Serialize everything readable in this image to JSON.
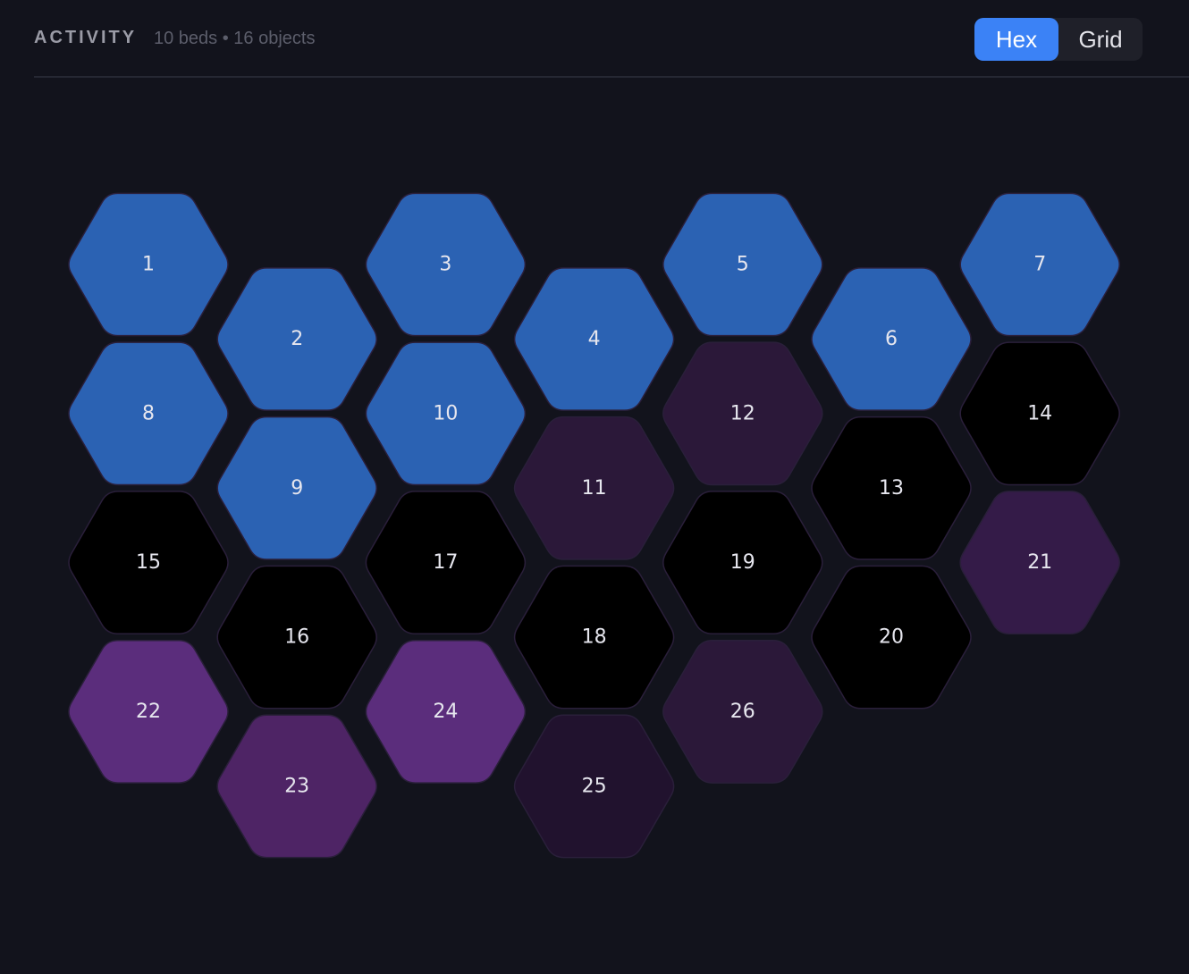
{
  "header": {
    "title": "ACTIVITY",
    "subtitle": "10 beds • 16 objects"
  },
  "view_toggle": {
    "options": [
      "Hex",
      "Grid"
    ],
    "selected": "Hex"
  },
  "palette": {
    "blue": "#2b62b3",
    "black": "#000000",
    "purple_dark": "#2b1839",
    "purple_mid": "#4e2465",
    "purple_bright": "#5b2d7c",
    "purple_soft": "#341b48",
    "purple_deep": "#21122e",
    "hex_border": "#2a1f3a",
    "toggle_accent": "#3b82f6"
  },
  "cells": [
    {
      "label": "1",
      "color": "blue"
    },
    {
      "label": "2",
      "color": "blue"
    },
    {
      "label": "3",
      "color": "blue"
    },
    {
      "label": "4",
      "color": "blue"
    },
    {
      "label": "5",
      "color": "blue"
    },
    {
      "label": "6",
      "color": "blue"
    },
    {
      "label": "7",
      "color": "blue"
    },
    {
      "label": "8",
      "color": "blue"
    },
    {
      "label": "9",
      "color": "blue"
    },
    {
      "label": "10",
      "color": "blue"
    },
    {
      "label": "11",
      "color": "purple_dark"
    },
    {
      "label": "12",
      "color": "purple_dark"
    },
    {
      "label": "13",
      "color": "black"
    },
    {
      "label": "14",
      "color": "black"
    },
    {
      "label": "15",
      "color": "black"
    },
    {
      "label": "16",
      "color": "black"
    },
    {
      "label": "17",
      "color": "black"
    },
    {
      "label": "18",
      "color": "black"
    },
    {
      "label": "19",
      "color": "black"
    },
    {
      "label": "20",
      "color": "black"
    },
    {
      "label": "21",
      "color": "purple_soft"
    },
    {
      "label": "22",
      "color": "purple_bright"
    },
    {
      "label": "23",
      "color": "purple_mid"
    },
    {
      "label": "24",
      "color": "purple_bright"
    },
    {
      "label": "25",
      "color": "purple_deep"
    },
    {
      "label": "26",
      "color": "purple_dark"
    }
  ]
}
